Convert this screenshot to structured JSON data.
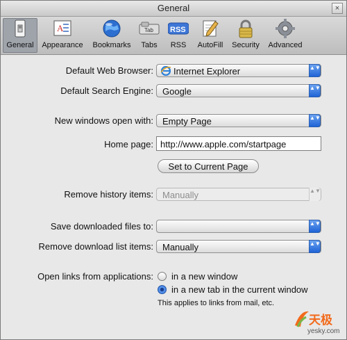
{
  "window": {
    "title": "General",
    "close_glyph": "×"
  },
  "toolbar": {
    "items": [
      {
        "label": "General",
        "icon": "switch-icon",
        "selected": true
      },
      {
        "label": "Appearance",
        "icon": "appearance-icon",
        "selected": false
      },
      {
        "label": "Bookmarks",
        "icon": "globe-icon",
        "selected": false
      },
      {
        "label": "Tabs",
        "icon": "tabs-icon",
        "selected": false,
        "icon_text": "Tab"
      },
      {
        "label": "RSS",
        "icon": "rss-icon",
        "selected": false,
        "icon_text": "RSS"
      },
      {
        "label": "AutoFill",
        "icon": "pencil-icon",
        "selected": false
      },
      {
        "label": "Security",
        "icon": "lock-icon",
        "selected": false
      },
      {
        "label": "Advanced",
        "icon": "gear-icon",
        "selected": false
      }
    ]
  },
  "settings": {
    "default_browser": {
      "label": "Default Web Browser:",
      "value": "Internet Explorer",
      "icon": "ie-icon"
    },
    "search_engine": {
      "label": "Default Search Engine:",
      "value": "Google"
    },
    "new_windows": {
      "label": "New windows open with:",
      "value": "Empty Page"
    },
    "home_page": {
      "label": "Home page:",
      "value": "http://www.apple.com/startpage"
    },
    "set_current_page": {
      "label": "Set to Current Page"
    },
    "remove_history": {
      "label": "Remove history items:",
      "value": "Manually",
      "disabled": true
    },
    "save_downloads": {
      "label": "Save downloaded files to:",
      "value": ""
    },
    "remove_download_list": {
      "label": "Remove download list items:",
      "value": "Manually"
    },
    "open_links": {
      "label": "Open links from applications:",
      "options": [
        "in a new window",
        "in a new tab in the current window"
      ],
      "selected_index": 1,
      "note": "This applies to links from mail, etc."
    }
  },
  "popup_arrows": "▲▼",
  "watermark": {
    "brand_cn": "天极",
    "domain": "yesky.com",
    "accent": "#f26a1b"
  },
  "colors": {
    "accent_blue": "#2f6fd8",
    "window_bg": "#e8e8e8"
  }
}
